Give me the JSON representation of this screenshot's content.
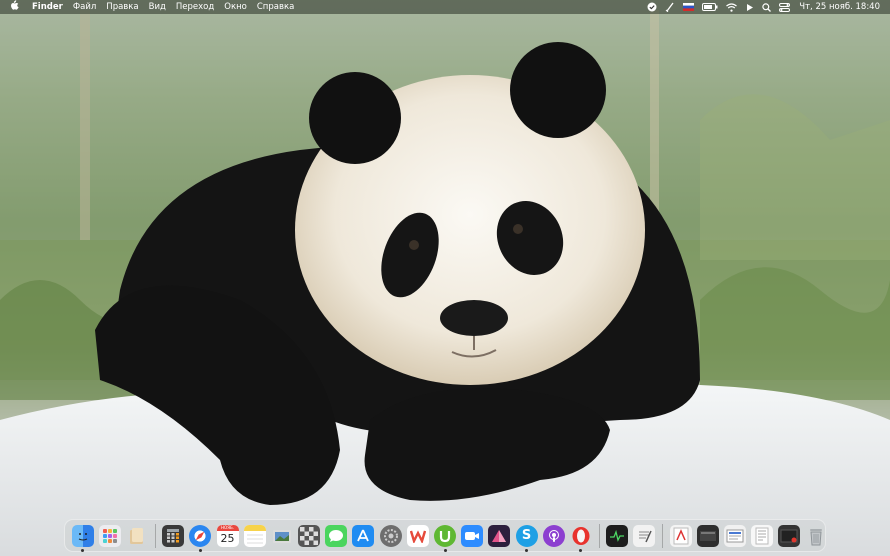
{
  "menubar": {
    "apple_icon": "apple-logo",
    "app_name": "Finder",
    "menus": [
      "Файл",
      "Правка",
      "Вид",
      "Переход",
      "Окно",
      "Справка"
    ],
    "status_icons": [
      "checkmark-badge-icon",
      "brush-icon",
      "flag-icon",
      "battery-icon",
      "wifi-icon",
      "play-icon",
      "search-icon",
      "control-center-icon"
    ],
    "clock": "Чт, 25 нояб.  18:40"
  },
  "dock": {
    "calendar": {
      "month": "НОЯБ.",
      "day": "25"
    },
    "items": [
      {
        "name": "finder",
        "color": "#3b8ef0"
      },
      {
        "name": "launchpad",
        "color": "#e9e9ee"
      },
      {
        "name": "files",
        "color": "#d7b98d"
      },
      {
        "name": "calculator",
        "color": "#3a3a3a"
      },
      {
        "name": "safari",
        "color": "#2a86f0"
      },
      {
        "name": "calendar",
        "color": "#ffffff"
      },
      {
        "name": "notes",
        "color": "#f7d34b"
      },
      {
        "name": "preview",
        "color": "#6b8fb6"
      },
      {
        "name": "chess",
        "color": "#444444"
      },
      {
        "name": "messages",
        "color": "#4ad55e"
      },
      {
        "name": "app-store",
        "color": "#1f8cf2"
      },
      {
        "name": "system-preferences",
        "color": "#7b7b7b"
      },
      {
        "name": "wps-office",
        "color": "#e64a3b"
      },
      {
        "name": "utorrent",
        "color": "#5fb833"
      },
      {
        "name": "zoom",
        "color": "#2d8cff"
      },
      {
        "name": "affinity",
        "color": "#e2548b"
      },
      {
        "name": "skype",
        "color": "#1ea0e5"
      },
      {
        "name": "podcasts",
        "color": "#8c3fd0"
      },
      {
        "name": "opera",
        "color": "#e8332e"
      },
      {
        "name": "activity-monitor",
        "color": "#222222"
      },
      {
        "name": "textedit",
        "color": "#f2f2f2"
      },
      {
        "name": "doc-thumbnail-1",
        "color": "#f4f4f4"
      },
      {
        "name": "doc-thumbnail-2",
        "color": "#2e2e2e"
      },
      {
        "name": "doc-thumbnail-3",
        "color": "#f1f1f1"
      },
      {
        "name": "doc-thumbnail-4",
        "color": "#f7f7f7"
      },
      {
        "name": "doc-thumbnail-5",
        "color": "#333333"
      },
      {
        "name": "trash",
        "color": "#9aa0a4"
      }
    ]
  }
}
